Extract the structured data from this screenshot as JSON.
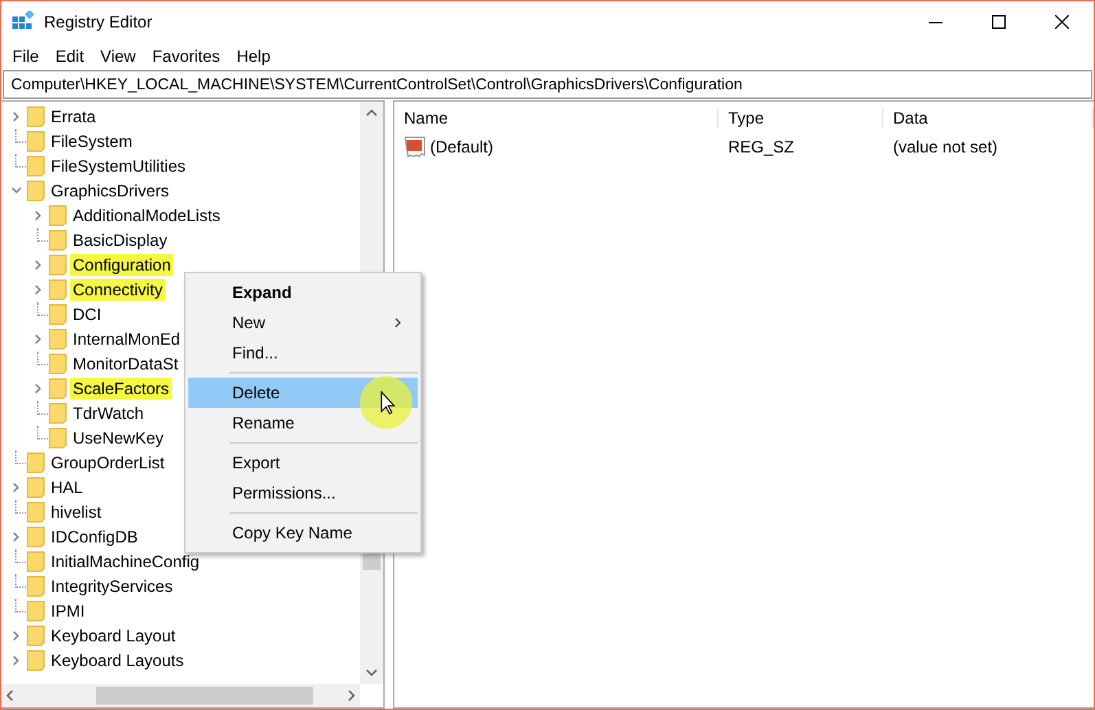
{
  "window": {
    "title": "Registry Editor"
  },
  "menu_bar": [
    "File",
    "Edit",
    "View",
    "Favorites",
    "Help"
  ],
  "address": "Computer\\HKEY_LOCAL_MACHINE\\SYSTEM\\CurrentControlSet\\Control\\GraphicsDrivers\\Configuration",
  "tree": [
    {
      "label": "Errata",
      "expanded": false,
      "highlighted": false
    },
    {
      "label": "FileSystem",
      "highlighted": false
    },
    {
      "label": "FileSystemUtilities",
      "highlighted": false
    },
    {
      "label": "GraphicsDrivers",
      "expanded": true,
      "highlighted": false,
      "children": [
        {
          "label": "AdditionalModeLists",
          "expanded": false,
          "highlighted": false
        },
        {
          "label": "BasicDisplay",
          "highlighted": false
        },
        {
          "label": "Configuration",
          "expanded": false,
          "highlighted": true
        },
        {
          "label": "Connectivity",
          "expanded": false,
          "highlighted": true
        },
        {
          "label": "DCI",
          "highlighted": false
        },
        {
          "label": "InternalMonEd",
          "expanded": false,
          "highlighted": false
        },
        {
          "label": "MonitorDataSt",
          "highlighted": false
        },
        {
          "label": "ScaleFactors",
          "expanded": false,
          "highlighted": true
        },
        {
          "label": "TdrWatch",
          "highlighted": false
        },
        {
          "label": "UseNewKey",
          "highlighted": false
        }
      ]
    },
    {
      "label": "GroupOrderList",
      "highlighted": false
    },
    {
      "label": "HAL",
      "expanded": false,
      "highlighted": false
    },
    {
      "label": "hivelist",
      "highlighted": false
    },
    {
      "label": "IDConfigDB",
      "expanded": false,
      "highlighted": false
    },
    {
      "label": "InitialMachineConfig",
      "highlighted": false
    },
    {
      "label": "IntegrityServices",
      "highlighted": false
    },
    {
      "label": "IPMI",
      "highlighted": false
    },
    {
      "label": "Keyboard Layout",
      "expanded": false,
      "highlighted": false
    },
    {
      "label": "Keyboard Layouts",
      "expanded": false,
      "highlighted": false
    }
  ],
  "values_table": {
    "columns": [
      "Name",
      "Type",
      "Data"
    ],
    "rows": [
      {
        "name": "(Default)",
        "type": "REG_SZ",
        "data": "(value not set)"
      }
    ]
  },
  "context_menu": [
    {
      "kind": "default",
      "label": "Expand",
      "selected": false
    },
    {
      "kind": "submenu",
      "label": "New",
      "selected": false
    },
    {
      "kind": "item",
      "label": "Find...",
      "selected": false
    },
    {
      "kind": "separator"
    },
    {
      "kind": "item",
      "label": "Delete",
      "selected": true
    },
    {
      "kind": "item",
      "label": "Rename",
      "selected": false
    },
    {
      "kind": "separator"
    },
    {
      "kind": "item",
      "label": "Export",
      "selected": false
    },
    {
      "kind": "item",
      "label": "Permissions...",
      "selected": false
    },
    {
      "kind": "separator"
    },
    {
      "kind": "item",
      "label": "Copy Key Name",
      "selected": false
    }
  ]
}
